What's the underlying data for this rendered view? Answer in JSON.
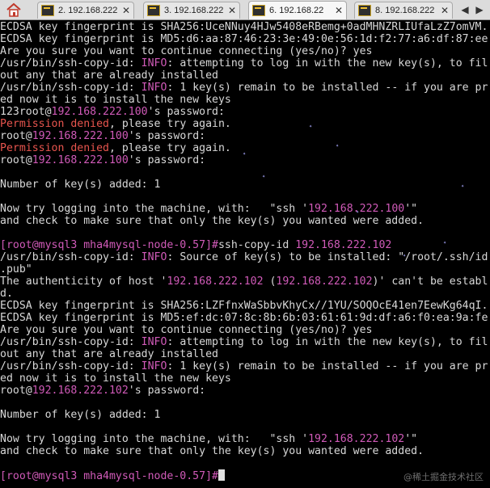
{
  "tabs": [
    {
      "label": "2. 192.168.222",
      "active": false
    },
    {
      "label": "3. 192.168.222",
      "active": false
    },
    {
      "label": "6. 192.168.22",
      "active": true
    },
    {
      "label": "8. 192.168.222",
      "active": false
    }
  ],
  "tab_close_glyph": "✕",
  "nav": {
    "prev": "◀",
    "next": "▶"
  },
  "colors": {
    "background": "#000000",
    "text": "#d8d8d8",
    "ip_highlight": "#d05ab8",
    "error": "#e8554e"
  },
  "terminal_lines": [
    [
      {
        "t": "ECDSA key fingerprint is SHA256:UceNNuy4HJw5408eRBemg+0adMHNZRLIUfaLzZ7omVM."
      }
    ],
    [
      {
        "t": "ECDSA key fingerprint is MD5:d6:aa:87:46:23:3e:49:0e:56:1d:f2:77:a6:df:87:ee"
      }
    ],
    [
      {
        "t": "Are you sure you want to continue connecting (yes/no)? yes"
      }
    ],
    [
      {
        "t": "/usr/bin/ssh-copy-id: "
      },
      {
        "t": "INFO",
        "c": "pk"
      },
      {
        "t": ": attempting to log in with the new key(s), to fil"
      }
    ],
    [
      {
        "t": "out any that are already installed"
      }
    ],
    [
      {
        "t": "/usr/bin/ssh-copy-id: "
      },
      {
        "t": "INFO",
        "c": "pk"
      },
      {
        "t": ": 1 key(s) remain to be installed -- if you are pr"
      }
    ],
    [
      {
        "t": "ed now it is to install the new keys"
      }
    ],
    [
      {
        "t": "123root@"
      },
      {
        "t": "192.168.222.100",
        "c": "pk"
      },
      {
        "t": "'s password:"
      }
    ],
    [
      {
        "t": "Permission denied",
        "c": "rd"
      },
      {
        "t": ", please try again."
      }
    ],
    [
      {
        "t": "root@"
      },
      {
        "t": "192.168.222.100",
        "c": "pk"
      },
      {
        "t": "'s password:"
      }
    ],
    [
      {
        "t": "Permission denied",
        "c": "rd"
      },
      {
        "t": ", please try again."
      }
    ],
    [
      {
        "t": "root@"
      },
      {
        "t": "192.168.222.100",
        "c": "pk"
      },
      {
        "t": "'s password:"
      }
    ],
    [
      {
        "t": ""
      }
    ],
    [
      {
        "t": "Number of key(s) added: 1"
      }
    ],
    [
      {
        "t": ""
      }
    ],
    [
      {
        "t": "Now try logging into the machine, with:   \"ssh '"
      },
      {
        "t": "192.168.222.100",
        "c": "pk"
      },
      {
        "t": "'\""
      }
    ],
    [
      {
        "t": "and check to make sure that only the key(s) you wanted were added."
      }
    ],
    [
      {
        "t": ""
      }
    ],
    [
      {
        "t": "[root@mysql3 mha4mysql-node-0.57]#",
        "c": "pk"
      },
      {
        "t": "ssh-copy-id "
      },
      {
        "t": "192.168.222.102",
        "c": "pk"
      }
    ],
    [
      {
        "t": "/usr/bin/ssh-copy-id: "
      },
      {
        "t": "INFO",
        "c": "pk"
      },
      {
        "t": ": Source of key(s) to be installed: \"/root/.ssh/id"
      }
    ],
    [
      {
        "t": ".pub\""
      }
    ],
    [
      {
        "t": "The authenticity of host '"
      },
      {
        "t": "192.168.222.102",
        "c": "pk"
      },
      {
        "t": " ("
      },
      {
        "t": "192.168.222.102",
        "c": "pk"
      },
      {
        "t": ")' can't be establ"
      }
    ],
    [
      {
        "t": "d."
      }
    ],
    [
      {
        "t": "ECDSA key fingerprint is SHA256:LZFfnxWaSbbvKhyCx//1YU/SOQOcE41en7EewKg64qI."
      }
    ],
    [
      {
        "t": "ECDSA key fingerprint is MD5:ef:dc:07:8c:8b:6b:03:61:61:9d:df:a6:f0:ea:9a:fe"
      }
    ],
    [
      {
        "t": "Are you sure you want to continue connecting (yes/no)? yes"
      }
    ],
    [
      {
        "t": "/usr/bin/ssh-copy-id: "
      },
      {
        "t": "INFO",
        "c": "pk"
      },
      {
        "t": ": attempting to log in with the new key(s), to fil"
      }
    ],
    [
      {
        "t": "out any that are already installed"
      }
    ],
    [
      {
        "t": "/usr/bin/ssh-copy-id: "
      },
      {
        "t": "INFO",
        "c": "pk"
      },
      {
        "t": ": 1 key(s) remain to be installed -- if you are pr"
      }
    ],
    [
      {
        "t": "ed now it is to install the new keys"
      }
    ],
    [
      {
        "t": "root@"
      },
      {
        "t": "192.168.222.102",
        "c": "pk"
      },
      {
        "t": "'s password:"
      }
    ],
    [
      {
        "t": ""
      }
    ],
    [
      {
        "t": "Number of key(s) added: 1"
      }
    ],
    [
      {
        "t": ""
      }
    ],
    [
      {
        "t": "Now try logging into the machine, with:   \"ssh '"
      },
      {
        "t": "192.168.222.102",
        "c": "pk"
      },
      {
        "t": "'\""
      }
    ],
    [
      {
        "t": "and check to make sure that only the key(s) you wanted were added."
      }
    ],
    [
      {
        "t": ""
      }
    ],
    [
      {
        "t": "[root@mysql3 mha4mysql-node-0.57]#",
        "c": "pk"
      }
    ]
  ],
  "watermark": "@稀土掘金技术社区"
}
